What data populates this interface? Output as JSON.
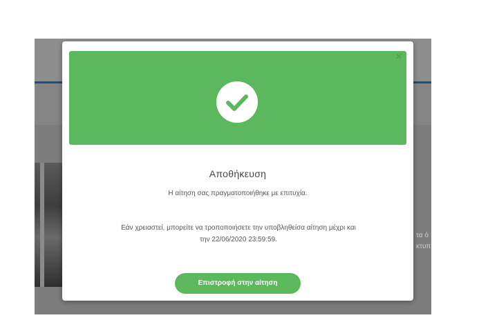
{
  "background": {
    "side_text_lines": [
      "τα ό",
      "κτυπ"
    ]
  },
  "modal": {
    "banner_color": "#5cb85c",
    "banner_icon": "check-icon",
    "close_icon": "close-icon",
    "title": "Αποθήκευση",
    "subtitle": "Η αίτηση σας πραγματοποιήθηκε με επιτυχία.",
    "info_line1": "Εάν χρειαστεί, μπορείτε να τροποποιήσετε την υποβληθείσα αίτηση μέχρι και",
    "info_line2": "την 22/06/2020 23:59:59.",
    "return_button_label": "Επιστροφή στην αίτηση"
  }
}
